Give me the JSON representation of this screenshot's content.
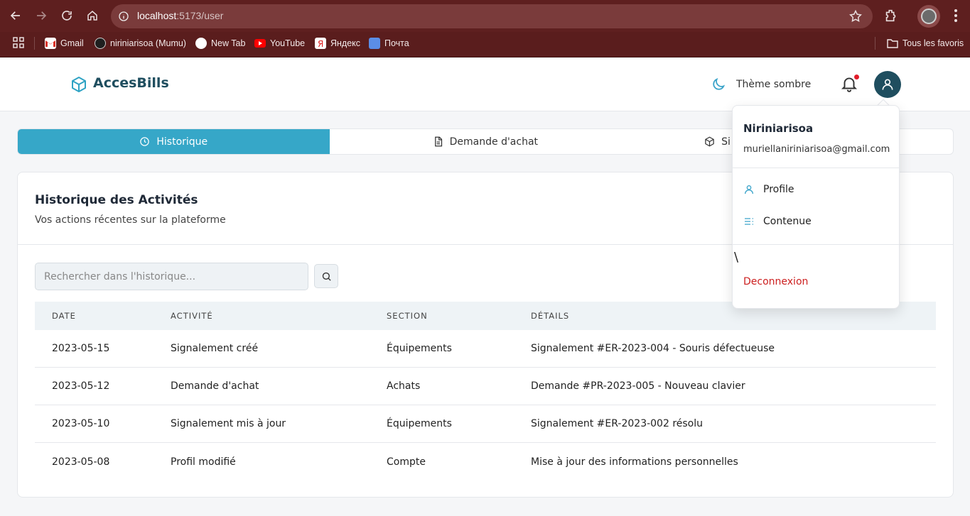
{
  "browser": {
    "url_host": "localhost",
    "url_path": ":5173/user",
    "bookmarks": [
      {
        "label": "Gmail",
        "color": "#ffffff"
      },
      {
        "label": "niriniarisoa (Mumu)",
        "color": "#1f1f1f"
      },
      {
        "label": "New Tab",
        "color": "#ffffff"
      },
      {
        "label": "YouTube",
        "color": "#ff0000"
      },
      {
        "label": "Яндекс",
        "color": "#ffffff"
      },
      {
        "label": "Почта",
        "color": "#5b8de6"
      }
    ],
    "all_bookmarks_label": "Tous les favoris"
  },
  "header": {
    "brand": "AccesBills",
    "theme_label": "Thème sombre",
    "notification_dot_color": "#e11d2a"
  },
  "tabs": [
    {
      "label": "Historique",
      "icon": "clock-icon",
      "active": true
    },
    {
      "label": "Demande d'achat",
      "icon": "document-icon",
      "active": false
    },
    {
      "label": "Si",
      "icon": "box-icon",
      "active": false
    }
  ],
  "card": {
    "title": "Historique des Activités",
    "subtitle": "Vos actions récentes sur la plateforme",
    "search_placeholder": "Rechercher dans l'historique..."
  },
  "table": {
    "headers": [
      "DATE",
      "ACTIVITÉ",
      "SECTION",
      "DÉTAILS"
    ],
    "rows": [
      [
        "2023-05-15",
        "Signalement créé",
        "Équipements",
        "Signalement #ER-2023-004 - Souris défectueuse"
      ],
      [
        "2023-05-12",
        "Demande d'achat",
        "Achats",
        "Demande #PR-2023-005 - Nouveau clavier"
      ],
      [
        "2023-05-10",
        "Signalement mis à jour",
        "Équipements",
        "Signalement #ER-2023-002 résolu"
      ],
      [
        "2023-05-08",
        "Profil modifié",
        "Compte",
        "Mise à jour des informations personnelles"
      ]
    ]
  },
  "user_menu": {
    "name": "Niriniarisoa",
    "email": "muriellaniriniarisoa@gmail.com",
    "profile_label": "Profile",
    "content_label": "Contenue",
    "stray_char": "\\",
    "logout_label": "Deconnexion"
  },
  "colors": {
    "accent": "#36a7c8",
    "brand_dark": "#1f4e5f",
    "logout": "#cc1f1f"
  }
}
